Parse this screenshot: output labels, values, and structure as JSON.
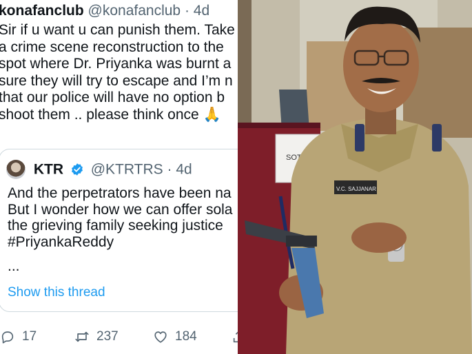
{
  "outer_tweet": {
    "display_name": "konafanclub",
    "handle": "@konafanclub",
    "separator": "·",
    "time": "4d",
    "lines": [
      "Sir if u want u can punish them. Take",
      "a crime scene reconstruction to the",
      "spot where Dr. Priyanka was burnt a",
      "sure they will try to escape and I’m n",
      "that our police will have no option b",
      "shoot them .. please think once 🙏"
    ]
  },
  "quoted_tweet": {
    "display_name": "KTR",
    "handle": "@KTRTRS",
    "separator": "·",
    "time": "4d",
    "lines": [
      "And the perpetrators have been na",
      "But I wonder how we can offer sola",
      "the grieving family seeking justice",
      "#PriyankaReddy"
    ],
    "more": "...",
    "show_thread": "Show this thread"
  },
  "actions": {
    "reply_count": "17",
    "retweet_count": "237",
    "like_count": "184"
  },
  "photo": {
    "board_text": "SOT M",
    "name_tag": "V.C. SAJJANAR"
  },
  "colors": {
    "text": "#0f1419",
    "muted": "#536471",
    "link": "#1d9bf0",
    "border": "#cfd9de",
    "uniform": "#b8a576"
  }
}
